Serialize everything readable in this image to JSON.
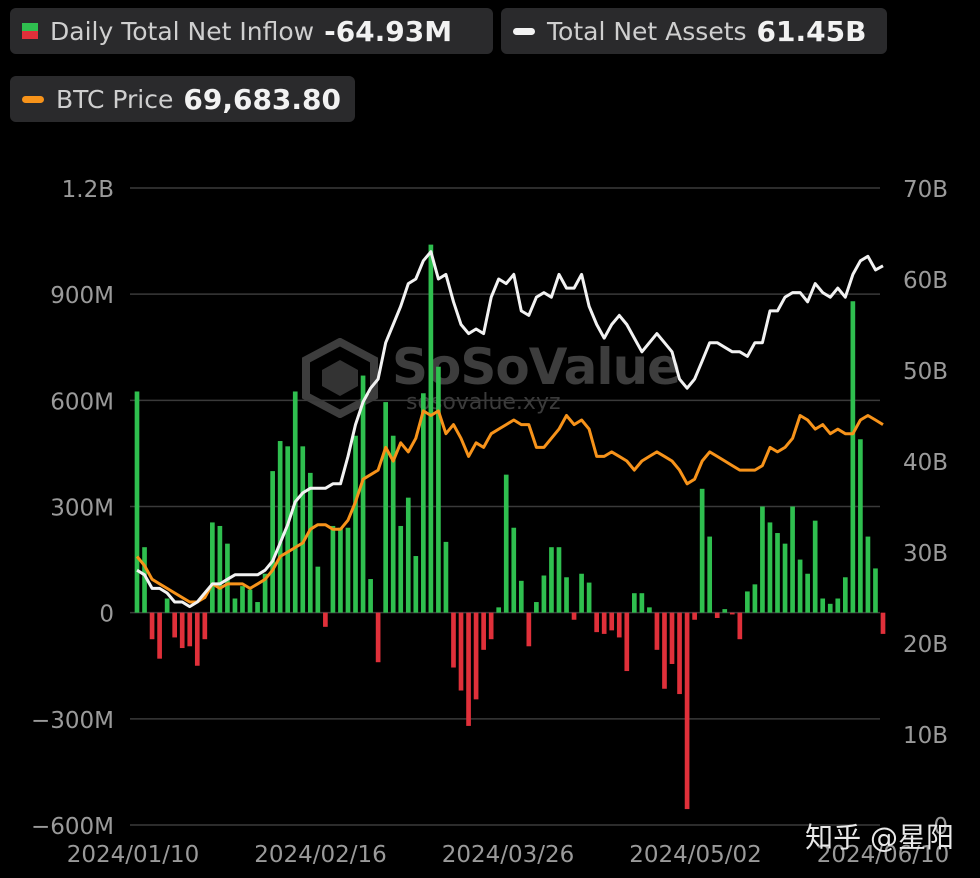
{
  "legend": {
    "inflow": {
      "label": "Daily Total Net Inflow",
      "value": "-64.93M"
    },
    "assets": {
      "label": "Total Net Assets",
      "value": "61.45B"
    },
    "btc": {
      "label": "BTC Price",
      "value": "69,683.80"
    }
  },
  "watermark": {
    "name": "SoSoValue",
    "url": "sosovalue.xyz"
  },
  "signature": "知乎 @星阳",
  "colors": {
    "positive": "#2fbf4f",
    "negative": "#e0303a",
    "assets_line": "#f2f2f2",
    "btc_line": "#f7931a",
    "grid": "#3a3a3a",
    "text": "#9a9a9a"
  },
  "chart_data": {
    "type": "bar",
    "x_axis": {
      "tick_labels": [
        "2024/01/10",
        "2024/02/16",
        "2024/03/26",
        "2024/05/02",
        "2024/06/10"
      ]
    },
    "y_left": {
      "tick_labels": [
        "1.2B",
        "900M",
        "600M",
        "300M",
        "0",
        "−300M",
        "−600M"
      ],
      "range": [
        -600,
        1200
      ],
      "unit": "M"
    },
    "y_right": {
      "tick_labels": [
        "70B",
        "60B",
        "50B",
        "40B",
        "30B",
        "20B",
        "10B",
        "0"
      ],
      "range": [
        0,
        70
      ],
      "unit": "B"
    },
    "series": [
      {
        "name": "Daily Total Net Inflow",
        "axis": "left",
        "unit": "M",
        "values": [
          625,
          185,
          -75,
          -130,
          40,
          -70,
          -100,
          -95,
          -150,
          -75,
          255,
          245,
          195,
          40,
          75,
          65,
          30,
          110,
          400,
          485,
          470,
          625,
          470,
          395,
          130,
          -40,
          245,
          240,
          240,
          500,
          670,
          95,
          -140,
          595,
          500,
          245,
          325,
          160,
          620,
          1040,
          695,
          200,
          -155,
          -220,
          -320,
          -245,
          -105,
          -75,
          15,
          390,
          240,
          90,
          -95,
          30,
          105,
          185,
          185,
          100,
          -20,
          110,
          85,
          -55,
          -60,
          -50,
          -70,
          -165,
          55,
          55,
          15,
          -105,
          -215,
          -145,
          -230,
          -555,
          -20,
          350,
          215,
          -15,
          10,
          -5,
          -75,
          60,
          80,
          300,
          255,
          225,
          195,
          300,
          150,
          110,
          260,
          40,
          25,
          40,
          100,
          880,
          490,
          215,
          125,
          -60
        ]
      },
      {
        "name": "Total Net Assets",
        "axis": "right",
        "unit": "B",
        "values": [
          28.0,
          27.5,
          26.0,
          26.0,
          25.5,
          24.5,
          24.5,
          24.0,
          24.5,
          25.5,
          26.5,
          26.5,
          27.0,
          27.5,
          27.5,
          27.5,
          27.5,
          28.0,
          29.0,
          31.0,
          33.0,
          35.5,
          36.5,
          37.0,
          37.0,
          37.0,
          37.5,
          37.5,
          40.5,
          44.0,
          46.5,
          48.0,
          49.0,
          53.0,
          55.0,
          57.0,
          59.5,
          60.0,
          62.0,
          63.0,
          60.0,
          60.5,
          57.5,
          55.0,
          54.0,
          54.5,
          54.0,
          58.0,
          60.0,
          59.5,
          60.5,
          56.5,
          56.0,
          58.0,
          58.5,
          58.0,
          60.5,
          59.0,
          59.0,
          60.5,
          57.0,
          55.0,
          53.5,
          55.0,
          56.0,
          55.0,
          53.5,
          52.0,
          53.0,
          54.0,
          53.0,
          52.0,
          49.0,
          48.0,
          49.0,
          51.0,
          53.0,
          53.0,
          52.5,
          52.0,
          52.0,
          51.5,
          53.0,
          53.0,
          56.5,
          56.5,
          58.0,
          58.5,
          58.5,
          57.5,
          59.5,
          58.5,
          58.0,
          59.0,
          58.0,
          60.5,
          62.0,
          62.5,
          61.0,
          61.45
        ]
      },
      {
        "name": "BTC Price",
        "axis": "right",
        "unit": "B-scale",
        "values": [
          29.5,
          28.5,
          27.0,
          26.5,
          26.0,
          25.5,
          25.0,
          24.5,
          24.5,
          25.0,
          26.5,
          26.0,
          26.5,
          26.5,
          26.5,
          26.0,
          26.5,
          27.0,
          28.0,
          29.5,
          30.0,
          30.5,
          31.0,
          32.5,
          33.0,
          33.0,
          32.5,
          32.5,
          33.5,
          35.5,
          38.0,
          38.5,
          39.0,
          41.5,
          40.0,
          42.0,
          41.0,
          42.5,
          45.5,
          45.0,
          45.5,
          43.0,
          44.0,
          42.5,
          40.5,
          42.0,
          41.5,
          43.0,
          43.5,
          44.0,
          44.5,
          44.0,
          44.0,
          41.5,
          41.5,
          42.5,
          43.5,
          45.0,
          44.0,
          44.5,
          43.5,
          40.5,
          40.5,
          41.0,
          40.5,
          40.0,
          39.0,
          40.0,
          40.5,
          41.0,
          40.5,
          40.0,
          39.0,
          37.5,
          38.0,
          40.0,
          41.0,
          40.5,
          40.0,
          39.5,
          39.0,
          39.0,
          39.0,
          39.5,
          41.5,
          41.0,
          41.5,
          42.5,
          45.0,
          44.5,
          43.5,
          44.0,
          43.0,
          43.5,
          43.0,
          43.0,
          44.5,
          45.0,
          44.5,
          44.0
        ]
      }
    ]
  }
}
